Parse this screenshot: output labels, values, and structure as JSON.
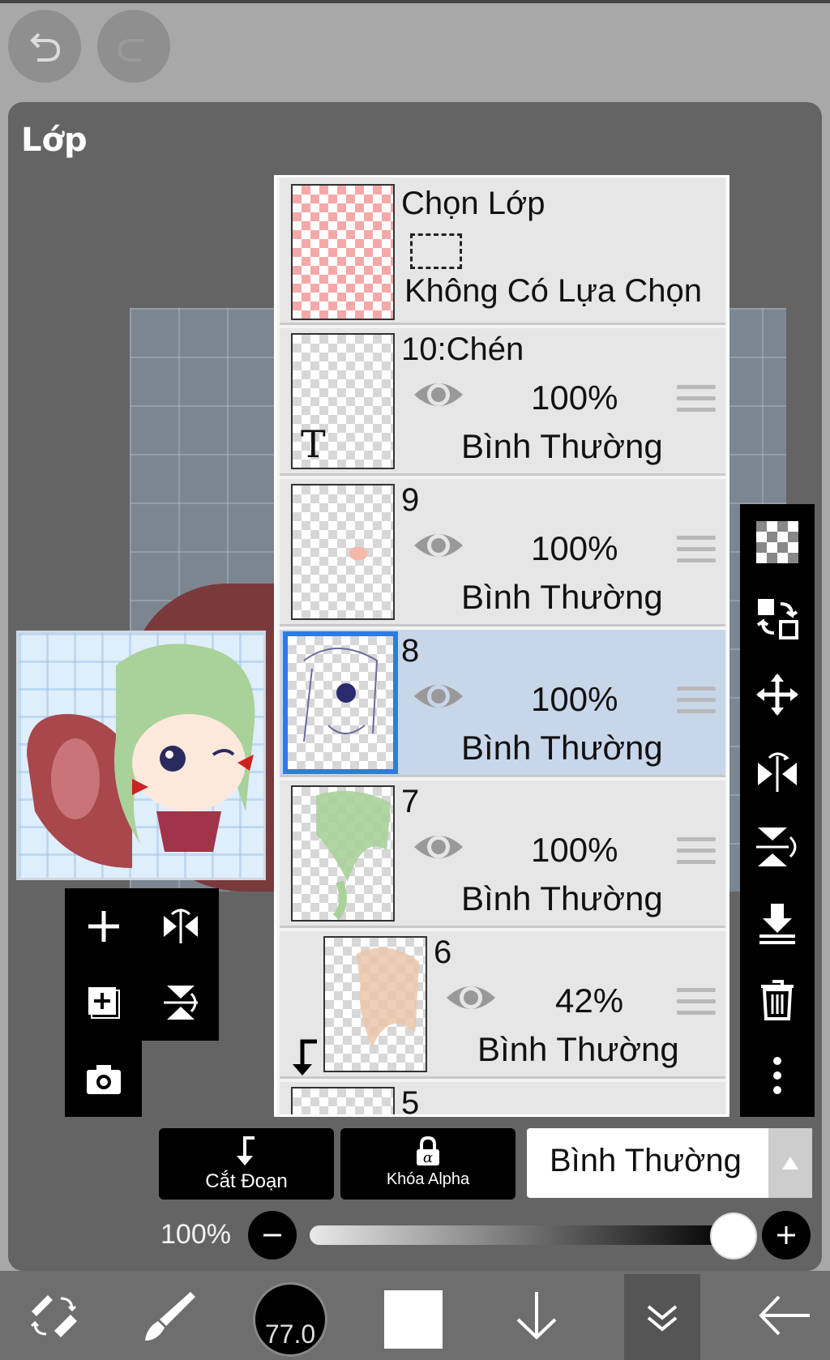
{
  "panel": {
    "title": "Lớp"
  },
  "layers": [
    {
      "id": "selection",
      "title": "Chọn Lớp",
      "subtitle": "Không Có Lựa Chọn"
    },
    {
      "name": "10:Chén",
      "opacity": "100%",
      "blend": "Bình Thường",
      "text_glyph": "T"
    },
    {
      "name": "9",
      "opacity": "100%",
      "blend": "Bình Thường"
    },
    {
      "name": "8",
      "opacity": "100%",
      "blend": "Bình Thường",
      "selected": true
    },
    {
      "name": "7",
      "opacity": "100%",
      "blend": "Bình Thường"
    },
    {
      "name": "6",
      "opacity": "42%",
      "blend": "Bình Thường",
      "clipped": true
    },
    {
      "name": "5"
    }
  ],
  "controls": {
    "clipping_label": "Cắt Đoạn",
    "alpha_lock_label": "Khóa Alpha",
    "blend_mode": "Bình Thường",
    "opacity_label": "100%",
    "opacity_value": 1.0
  },
  "toolbar": {
    "brush_size": "77.0"
  },
  "colors": {
    "selected_row": "#c8d6ea",
    "selected_border": "#2f7be0",
    "panel": "#646464"
  }
}
